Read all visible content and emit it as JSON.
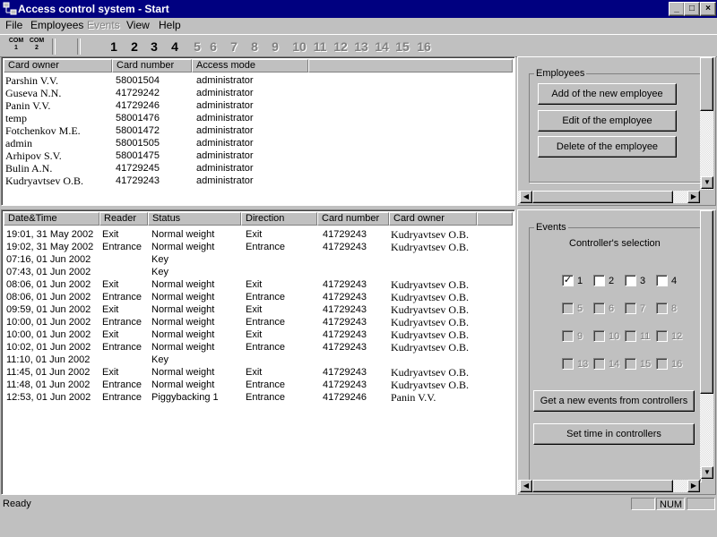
{
  "window": {
    "title": "Access control system - Start",
    "icon": "network-icon",
    "buttons": {
      "minimize": "_",
      "maximize": "□",
      "close": "×"
    }
  },
  "menu": {
    "file": "File",
    "employees": "Employees",
    "events": "Events",
    "view": "View",
    "help": "Help"
  },
  "toolbar": {
    "com1_top": "COM",
    "com1_bottom": "1",
    "com2_top": "COM",
    "com2_bottom": "2",
    "numbers": [
      "1",
      "2",
      "3",
      "4",
      "5",
      "6",
      "7",
      "8",
      "9",
      "10",
      "11",
      "12",
      "13",
      "14",
      "15",
      "16"
    ],
    "active_numbers": [
      "1",
      "2",
      "3",
      "4"
    ]
  },
  "cards": {
    "columns": [
      "Card owner",
      "Card number",
      "Access mode"
    ],
    "rows": [
      {
        "owner": "Parshin V.V.",
        "number": "58001504",
        "mode": "administrator"
      },
      {
        "owner": "Guseva N.N.",
        "number": "41729242",
        "mode": "administrator"
      },
      {
        "owner": "Panin V.V.",
        "number": "41729246",
        "mode": "administrator"
      },
      {
        "owner": "temp",
        "number": "58001476",
        "mode": "administrator"
      },
      {
        "owner": "Fotchenkov M.E.",
        "number": "58001472",
        "mode": "administrator"
      },
      {
        "owner": "admin",
        "number": "58001505",
        "mode": "administrator"
      },
      {
        "owner": "Arhipov S.V.",
        "number": "58001475",
        "mode": "administrator"
      },
      {
        "owner": "Bulin A.N.",
        "number": "41729245",
        "mode": "administrator"
      },
      {
        "owner": "Kudryavtsev O.B.",
        "number": "41729243",
        "mode": "administrator"
      }
    ]
  },
  "events_log": {
    "columns": [
      "Date&Time",
      "Reader",
      "Status",
      "Direction",
      "Card number",
      "Card owner"
    ],
    "rows": [
      {
        "dt": "19:01, 31 May 2002",
        "reader": "Exit",
        "status": "Normal weight",
        "dir": "Exit",
        "card": "41729243",
        "owner": "Kudryavtsev O.B."
      },
      {
        "dt": "19:02, 31 May 2002",
        "reader": "Entrance",
        "status": "Normal weight",
        "dir": "Entrance",
        "card": "41729243",
        "owner": "Kudryavtsev O.B."
      },
      {
        "dt": "07:16, 01 Jun 2002",
        "reader": "",
        "status": "Key",
        "dir": "",
        "card": "",
        "owner": ""
      },
      {
        "dt": "07:43, 01 Jun 2002",
        "reader": "",
        "status": "Key",
        "dir": "",
        "card": "",
        "owner": ""
      },
      {
        "dt": "08:06, 01 Jun 2002",
        "reader": "Exit",
        "status": "Normal weight",
        "dir": "Exit",
        "card": "41729243",
        "owner": "Kudryavtsev O.B."
      },
      {
        "dt": "08:06, 01 Jun 2002",
        "reader": "Entrance",
        "status": "Normal weight",
        "dir": "Entrance",
        "card": "41729243",
        "owner": "Kudryavtsev O.B."
      },
      {
        "dt": "09:59, 01 Jun 2002",
        "reader": "Exit",
        "status": "Normal weight",
        "dir": "Exit",
        "card": "41729243",
        "owner": "Kudryavtsev O.B."
      },
      {
        "dt": "10:00, 01 Jun 2002",
        "reader": "Entrance",
        "status": "Normal weight",
        "dir": "Entrance",
        "card": "41729243",
        "owner": "Kudryavtsev O.B."
      },
      {
        "dt": "10:00, 01 Jun 2002",
        "reader": "Exit",
        "status": "Normal weight",
        "dir": "Exit",
        "card": "41729243",
        "owner": "Kudryavtsev O.B."
      },
      {
        "dt": "10:02, 01 Jun 2002",
        "reader": "Entrance",
        "status": "Normal weight",
        "dir": "Entrance",
        "card": "41729243",
        "owner": "Kudryavtsev O.B."
      },
      {
        "dt": "11:10, 01 Jun 2002",
        "reader": "",
        "status": "Key",
        "dir": "",
        "card": "",
        "owner": ""
      },
      {
        "dt": "11:45, 01 Jun 2002",
        "reader": "Exit",
        "status": "Normal weight",
        "dir": "Exit",
        "card": "41729243",
        "owner": "Kudryavtsev O.B."
      },
      {
        "dt": "11:48, 01 Jun 2002",
        "reader": "Entrance",
        "status": "Normal weight",
        "dir": "Entrance",
        "card": "41729243",
        "owner": "Kudryavtsev O.B."
      },
      {
        "dt": "12:53, 01 Jun 2002",
        "reader": "Entrance",
        "status": "Piggybacking 1",
        "dir": "Entrance",
        "card": "41729246",
        "owner": "Panin V.V."
      }
    ]
  },
  "employees_panel": {
    "group_label": "Employees",
    "add_button": "Add of the new employee",
    "edit_button": "Edit of the employee",
    "delete_button": "Delete of the employee"
  },
  "events_panel": {
    "group_label": "Events",
    "selection_label": "Controller's selection",
    "controllers": [
      {
        "label": "1",
        "checked": true,
        "enabled": true
      },
      {
        "label": "2",
        "checked": false,
        "enabled": true
      },
      {
        "label": "3",
        "checked": false,
        "enabled": true
      },
      {
        "label": "4",
        "checked": false,
        "enabled": true
      },
      {
        "label": "5",
        "checked": false,
        "enabled": false
      },
      {
        "label": "6",
        "checked": false,
        "enabled": false
      },
      {
        "label": "7",
        "checked": false,
        "enabled": false
      },
      {
        "label": "8",
        "checked": false,
        "enabled": false
      },
      {
        "label": "9",
        "checked": false,
        "enabled": false
      },
      {
        "label": "10",
        "checked": false,
        "enabled": false
      },
      {
        "label": "11",
        "checked": false,
        "enabled": false
      },
      {
        "label": "12",
        "checked": false,
        "enabled": false
      },
      {
        "label": "13",
        "checked": false,
        "enabled": false
      },
      {
        "label": "14",
        "checked": false,
        "enabled": false
      },
      {
        "label": "15",
        "checked": false,
        "enabled": false
      },
      {
        "label": "16",
        "checked": false,
        "enabled": false
      }
    ],
    "get_events_button": "Get a new events from controllers",
    "set_time_button": "Set time in controllers"
  },
  "statusbar": {
    "text": "Ready",
    "num": "NUM"
  }
}
